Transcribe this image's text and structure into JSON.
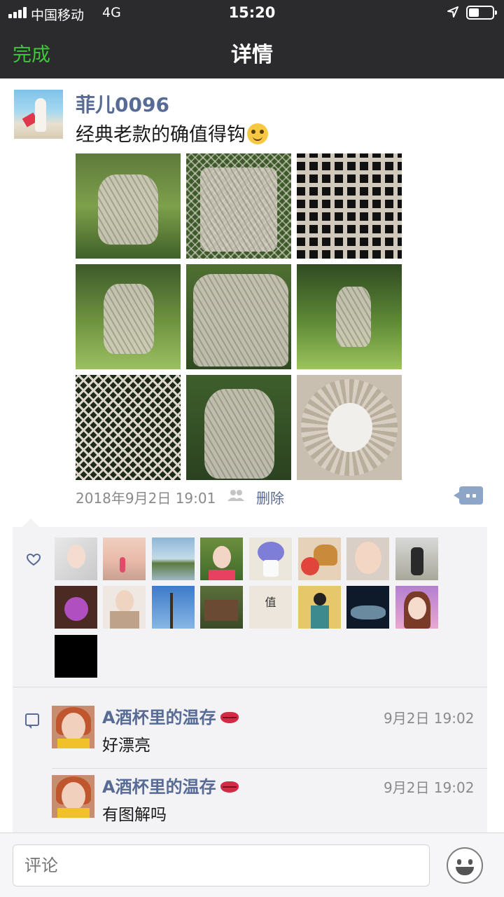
{
  "status_bar": {
    "carrier": "中国移动",
    "network": "4G",
    "time": "15:20",
    "battery_level": 0.45
  },
  "nav": {
    "done_label": "完成",
    "title": "详情"
  },
  "post": {
    "username": "菲儿0096",
    "text": "经典老款的确值得钩",
    "photo_count": 9,
    "time": "2018年9月2日 19:01",
    "delete_label": "删除"
  },
  "likes": {
    "avatar_count": 17
  },
  "comments": [
    {
      "name": "A酒杯里的温存",
      "time": "9月2日 19:02",
      "text": "好漂亮"
    },
    {
      "name": "A酒杯里的温存",
      "time": "9月2日 19:02",
      "text": "有图解吗"
    }
  ],
  "input": {
    "placeholder": "评论"
  },
  "colors": {
    "nav_bg": "#2b2b2d",
    "done_green": "#3fc63a",
    "link_blue": "#576b95",
    "panel_bg": "#f3f3f5"
  }
}
